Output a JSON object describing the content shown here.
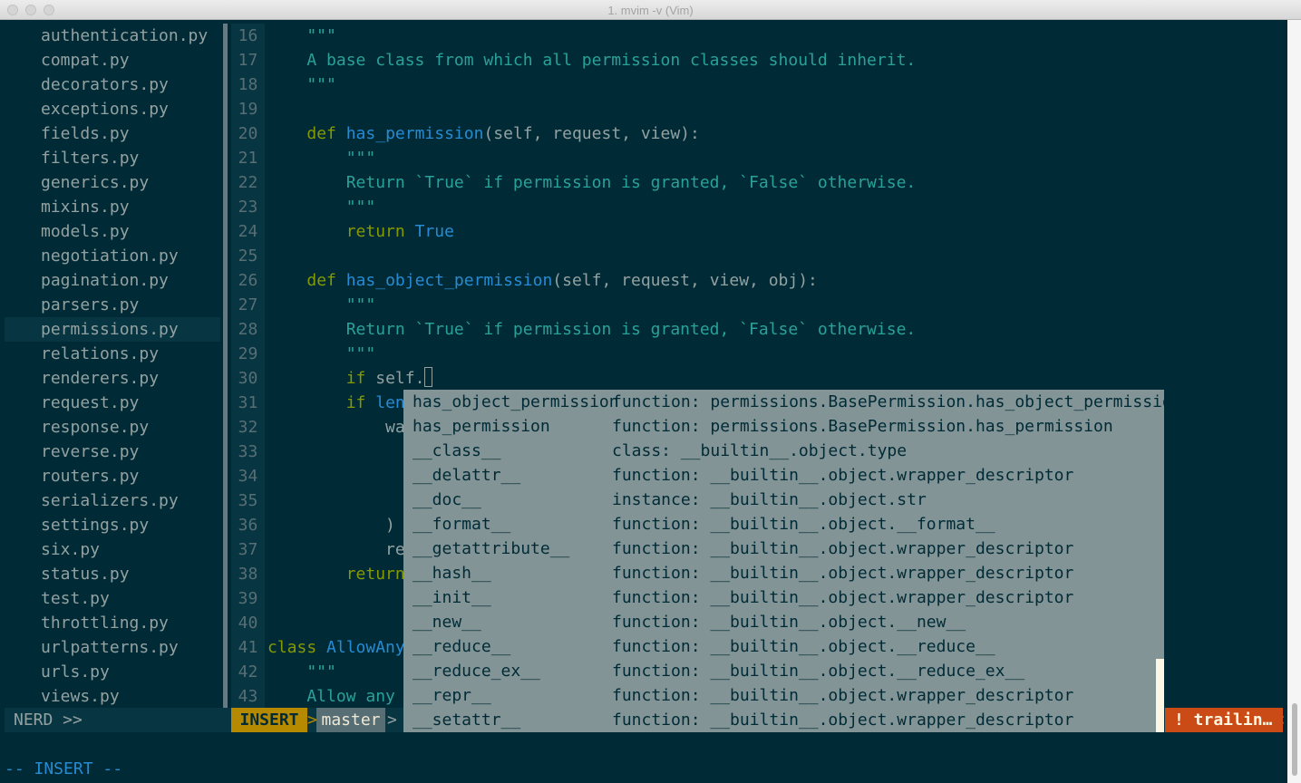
{
  "window": {
    "title": "1. mvim -v (Vim)"
  },
  "nerdtree": {
    "files": [
      "authentication.py",
      "compat.py",
      "decorators.py",
      "exceptions.py",
      "fields.py",
      "filters.py",
      "generics.py",
      "mixins.py",
      "models.py",
      "negotiation.py",
      "pagination.py",
      "parsers.py",
      "permissions.py",
      "relations.py",
      "renderers.py",
      "request.py",
      "response.py",
      "reverse.py",
      "routers.py",
      "serializers.py",
      "settings.py",
      "six.py",
      "status.py",
      "test.py",
      "throttling.py",
      "urlpatterns.py",
      "urls.py",
      "views.py"
    ],
    "current_file": "permissions.py"
  },
  "editor": {
    "lines": [
      {
        "n": "16",
        "text": "    \"\"\""
      },
      {
        "n": "17",
        "text": "    A base class from which all permission classes should inherit."
      },
      {
        "n": "18",
        "text": "    \"\"\""
      },
      {
        "n": "19",
        "text": ""
      },
      {
        "n": "20",
        "text": "    def has_permission(self, request, view):"
      },
      {
        "n": "21",
        "text": "        \"\"\""
      },
      {
        "n": "22",
        "text": "        Return `True` if permission is granted, `False` otherwise."
      },
      {
        "n": "23",
        "text": "        \"\"\""
      },
      {
        "n": "24",
        "text": "        return True"
      },
      {
        "n": "25",
        "text": ""
      },
      {
        "n": "26",
        "text": "    def has_object_permission(self, request, view, obj):"
      },
      {
        "n": "27",
        "text": "        \"\"\""
      },
      {
        "n": "28",
        "text": "        Return `True` if permission is granted, `False` otherwise."
      },
      {
        "n": "29",
        "text": "        \"\"\""
      },
      {
        "n": "30",
        "text": "        if self."
      },
      {
        "n": "31",
        "text": "        if len("
      },
      {
        "n": "32",
        "text": "            war"
      },
      {
        "n": "33",
        "text": ""
      },
      {
        "n": "34",
        "text": ""
      },
      {
        "n": "35",
        "text": ""
      },
      {
        "n": "36",
        "text": "            )"
      },
      {
        "n": "37",
        "text": "            ret"
      },
      {
        "n": "38",
        "text": "        return"
      },
      {
        "n": "39",
        "text": ""
      },
      {
        "n": "40",
        "text": ""
      },
      {
        "n": "41",
        "text": "class AllowAny("
      },
      {
        "n": "42",
        "text": "    \"\"\""
      },
      {
        "n": "43",
        "text": "    Allow any a"
      }
    ]
  },
  "completion": {
    "items": [
      {
        "word": "has_object_permission",
        "menu": "function: permissions.BasePermission.has_object_permission"
      },
      {
        "word": "has_permission",
        "menu": "function: permissions.BasePermission.has_permission"
      },
      {
        "word": "__class__",
        "menu": "class: __builtin__.object.type"
      },
      {
        "word": "__delattr__",
        "menu": "function: __builtin__.object.wrapper_descriptor"
      },
      {
        "word": "__doc__",
        "menu": "instance: __builtin__.object.str"
      },
      {
        "word": "__format__",
        "menu": "function: __builtin__.object.__format__"
      },
      {
        "word": "__getattribute__",
        "menu": "function: __builtin__.object.wrapper_descriptor"
      },
      {
        "word": "__hash__",
        "menu": "function: __builtin__.object.wrapper_descriptor"
      },
      {
        "word": "__init__",
        "menu": "function: __builtin__.object.wrapper_descriptor"
      },
      {
        "word": "__new__",
        "menu": "function: __builtin__.object.__new__"
      },
      {
        "word": "__reduce__",
        "menu": "function: __builtin__.object.__reduce__"
      },
      {
        "word": "__reduce_ex__",
        "menu": "function: __builtin__.object.__reduce_ex__"
      },
      {
        "word": "__repr__",
        "menu": "function: __builtin__.object.wrapper_descriptor"
      },
      {
        "word": "__setattr__",
        "menu": "function: __builtin__.object.wrapper_descriptor"
      }
    ]
  },
  "statusline": {
    "nerd": "NERD >>",
    "mode": "INSERT",
    "sep": ">",
    "branch": "master",
    "sep2": ">",
    "warning": "! trailin…",
    "warning_sep": "<"
  },
  "cmdline": "-- INSERT --",
  "colors": {
    "background": "#002b36",
    "keyword": "#859900",
    "function": "#268bd2",
    "docstring": "#2aa198",
    "mode_bg": "#b58900",
    "warning_bg": "#cb4b16",
    "popup_bg": "#839496"
  }
}
